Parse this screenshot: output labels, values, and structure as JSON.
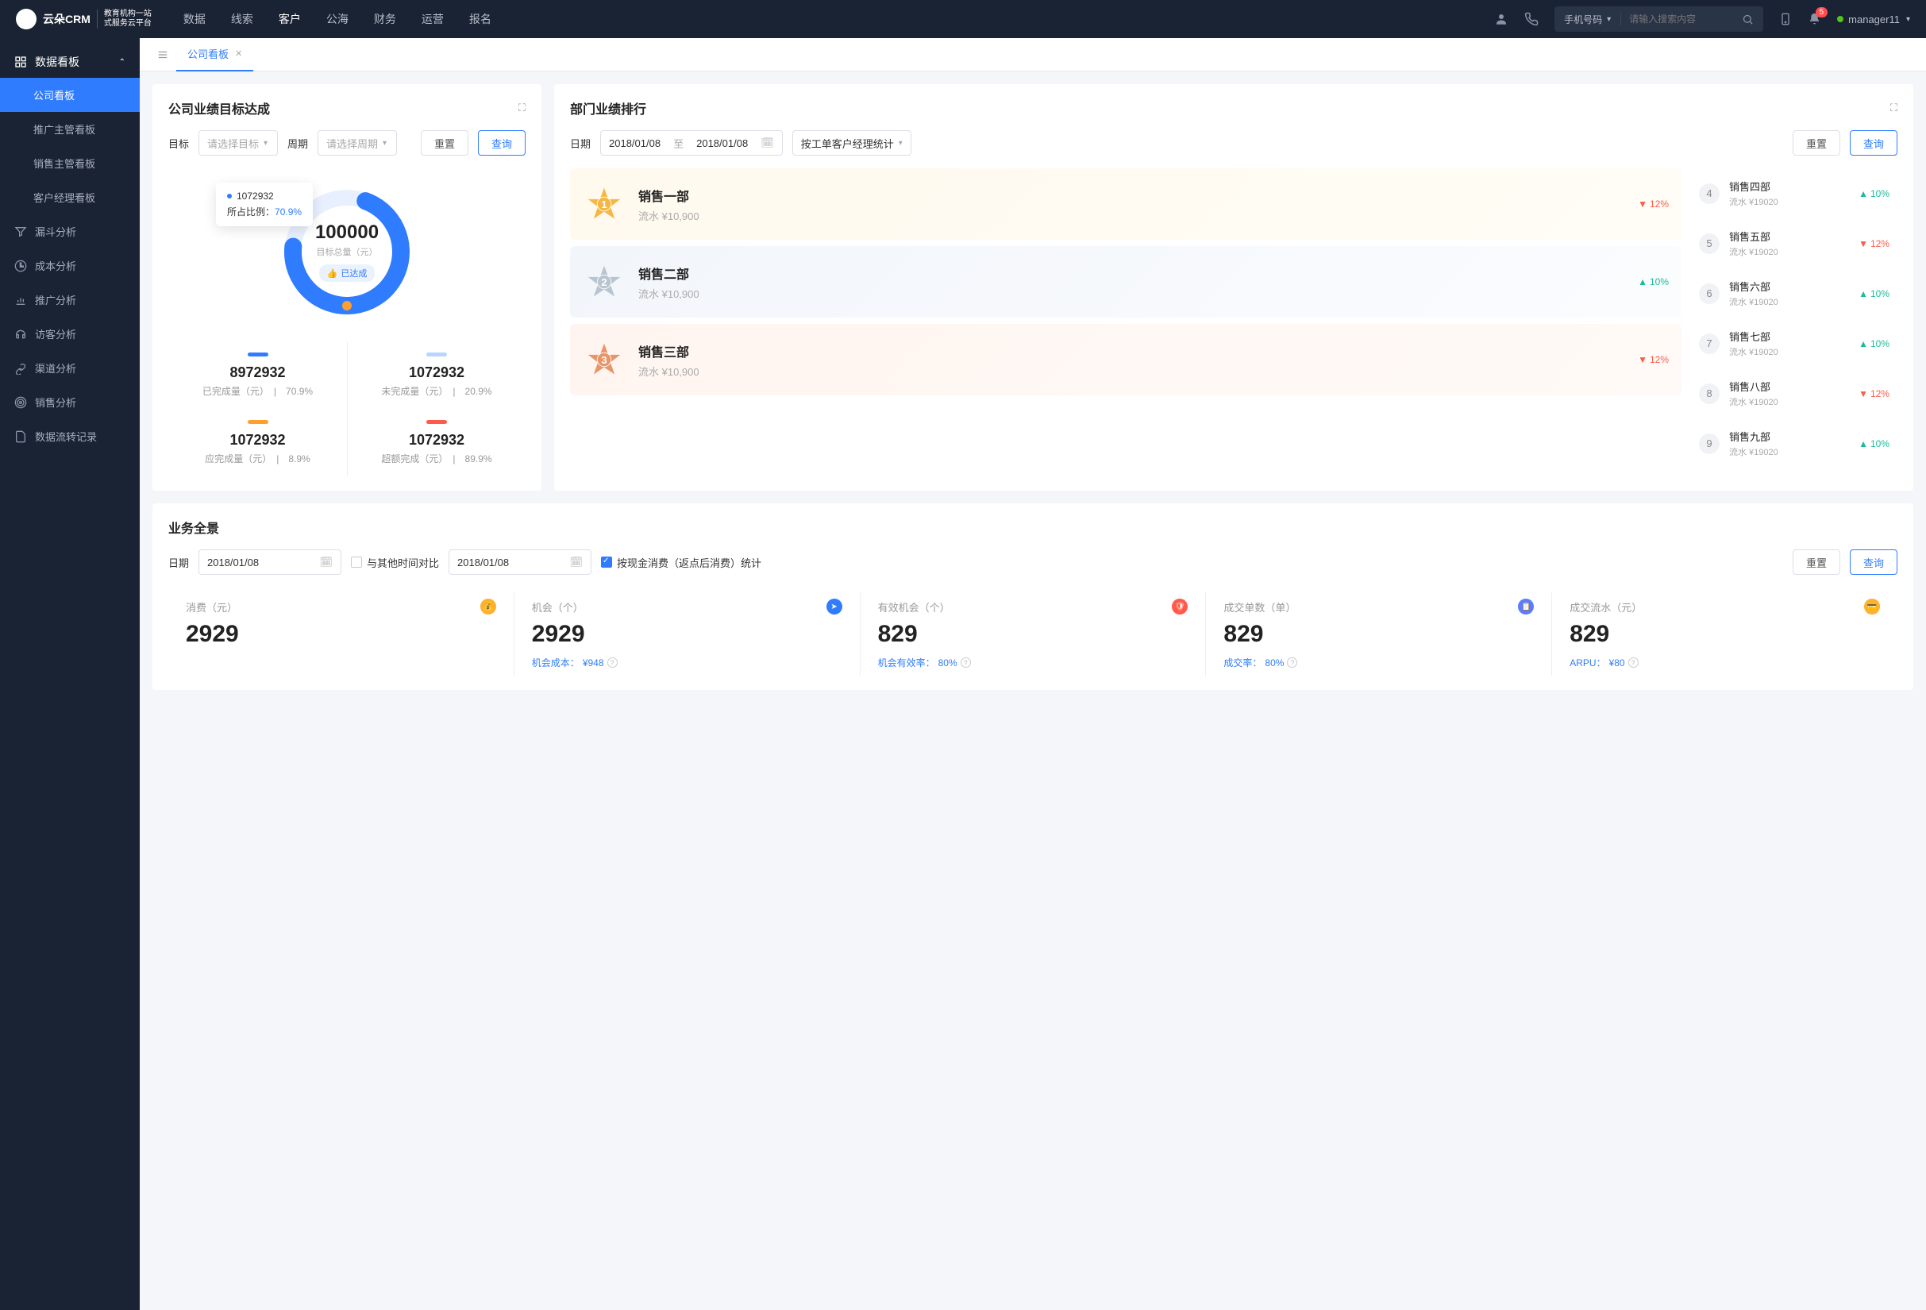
{
  "topbar": {
    "logo_main": "云朵CRM",
    "logo_sub1": "教育机构一站",
    "logo_sub2": "式服务云平台",
    "nav": [
      "数据",
      "线索",
      "客户",
      "公海",
      "财务",
      "运营",
      "报名"
    ],
    "active_nav": 2,
    "search_type": "手机号码",
    "search_placeholder": "请输入搜索内容",
    "badge": "5",
    "user": "manager11"
  },
  "sidebar": {
    "header": "数据看板",
    "sub": [
      "公司看板",
      "推广主管看板",
      "销售主管看板",
      "客户经理看板"
    ],
    "active_sub": 0,
    "items": [
      {
        "icon": "funnel",
        "label": "漏斗分析"
      },
      {
        "icon": "clock",
        "label": "成本分析"
      },
      {
        "icon": "chart",
        "label": "推广分析"
      },
      {
        "icon": "headset",
        "label": "访客分析"
      },
      {
        "icon": "link",
        "label": "渠道分析"
      },
      {
        "icon": "target",
        "label": "销售分析"
      },
      {
        "icon": "doc",
        "label": "数据流转记录"
      }
    ]
  },
  "tabs": {
    "current": "公司看板"
  },
  "target_card": {
    "title": "公司业绩目标达成",
    "filter_target_label": "目标",
    "filter_target_placeholder": "请选择目标",
    "filter_period_label": "周期",
    "filter_period_placeholder": "请选择周期",
    "reset": "重置",
    "query": "查询",
    "donut_total": "100000",
    "donut_label": "目标总量（元）",
    "achieved": "已达成",
    "tooltip_val": "1072932",
    "tooltip_label": "所占比例：",
    "tooltip_pct": "70.9%",
    "stats": [
      {
        "color": "blue",
        "num": "8972932",
        "label": "已完成量（元）",
        "pct": "70.9%"
      },
      {
        "color": "light",
        "num": "1072932",
        "label": "未完成量（元）",
        "pct": "20.9%"
      },
      {
        "color": "orange",
        "num": "1072932",
        "label": "应完成量（元）",
        "pct": "8.9%"
      },
      {
        "color": "red",
        "num": "1072932",
        "label": "超额完成（元）",
        "pct": "89.9%"
      }
    ]
  },
  "chart_data": {
    "type": "donut",
    "title": "目标总量（元）",
    "total": 100000,
    "series": [
      {
        "name": "已完成量（元）",
        "value": 8972932,
        "pct": 70.9,
        "color": "#2f7cff"
      },
      {
        "name": "未完成量（元）",
        "value": 1072932,
        "pct": 20.9,
        "color": "#b8d4ff"
      },
      {
        "name": "应完成量（元）",
        "value": 1072932,
        "pct": 8.9,
        "color": "#ff9f2e"
      },
      {
        "name": "超额完成（元）",
        "value": 1072932,
        "pct": 89.9,
        "color": "#ff5a4a"
      }
    ]
  },
  "rank_card": {
    "title": "部门业绩排行",
    "filter_date_label": "日期",
    "date_from": "2018/01/08",
    "date_to_label": "至",
    "date_to": "2018/01/08",
    "group_by": "按工单客户经理统计",
    "reset": "重置",
    "query": "查询",
    "top": [
      {
        "rank": "1",
        "name": "销售一部",
        "sub": "流水 ¥10,900",
        "pct": "12%",
        "dir": "down",
        "medal": "gold"
      },
      {
        "rank": "2",
        "name": "销售二部",
        "sub": "流水 ¥10,900",
        "pct": "10%",
        "dir": "up",
        "medal": "silver"
      },
      {
        "rank": "3",
        "name": "销售三部",
        "sub": "流水 ¥10,900",
        "pct": "12%",
        "dir": "down",
        "medal": "bronze"
      }
    ],
    "rest": [
      {
        "idx": "4",
        "name": "销售四部",
        "sub": "流水 ¥19020",
        "pct": "10%",
        "dir": "up"
      },
      {
        "idx": "5",
        "name": "销售五部",
        "sub": "流水 ¥19020",
        "pct": "12%",
        "dir": "down"
      },
      {
        "idx": "6",
        "name": "销售六部",
        "sub": "流水 ¥19020",
        "pct": "10%",
        "dir": "up"
      },
      {
        "idx": "7",
        "name": "销售七部",
        "sub": "流水 ¥19020",
        "pct": "10%",
        "dir": "up"
      },
      {
        "idx": "8",
        "name": "销售八部",
        "sub": "流水 ¥19020",
        "pct": "12%",
        "dir": "down"
      },
      {
        "idx": "9",
        "name": "销售九部",
        "sub": "流水 ¥19020",
        "pct": "10%",
        "dir": "up"
      }
    ]
  },
  "overview": {
    "title": "业务全景",
    "date_label": "日期",
    "date1": "2018/01/08",
    "compare_label": "与其他时间对比",
    "date2": "2018/01/08",
    "check_label": "按现金消费（返点后消费）统计",
    "reset": "重置",
    "query": "查询",
    "cards": [
      {
        "label": "消费（元）",
        "icon_bg": "#ffb02e",
        "num": "2929",
        "sub": ""
      },
      {
        "label": "机会（个）",
        "icon_bg": "#2f7cff",
        "num": "2929",
        "sub_label": "机会成本：",
        "sub_val": "¥948"
      },
      {
        "label": "有效机会（个）",
        "icon_bg": "#ff5a4a",
        "num": "829",
        "sub_label": "机会有效率：",
        "sub_val": "80%"
      },
      {
        "label": "成交单数（单）",
        "icon_bg": "#5a7cff",
        "num": "829",
        "sub_label": "成交率：",
        "sub_val": "80%"
      },
      {
        "label": "成交流水（元）",
        "icon_bg": "#ffb02e",
        "num": "829",
        "sub_label": "ARPU：",
        "sub_val": "¥80"
      }
    ]
  }
}
